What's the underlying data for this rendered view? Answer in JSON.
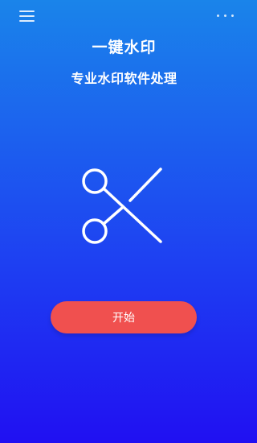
{
  "header": {
    "menu_icon": "hamburger-menu-icon",
    "more_icon": "more-dots-icon"
  },
  "main": {
    "title": "一键水印",
    "subtitle": "专业水印软件处理",
    "hero_icon": "scissors-icon",
    "start_button_label": "开始"
  },
  "colors": {
    "bg_top": "#1a84ea",
    "bg_bottom": "#2010f2",
    "button": "#f0504f"
  }
}
